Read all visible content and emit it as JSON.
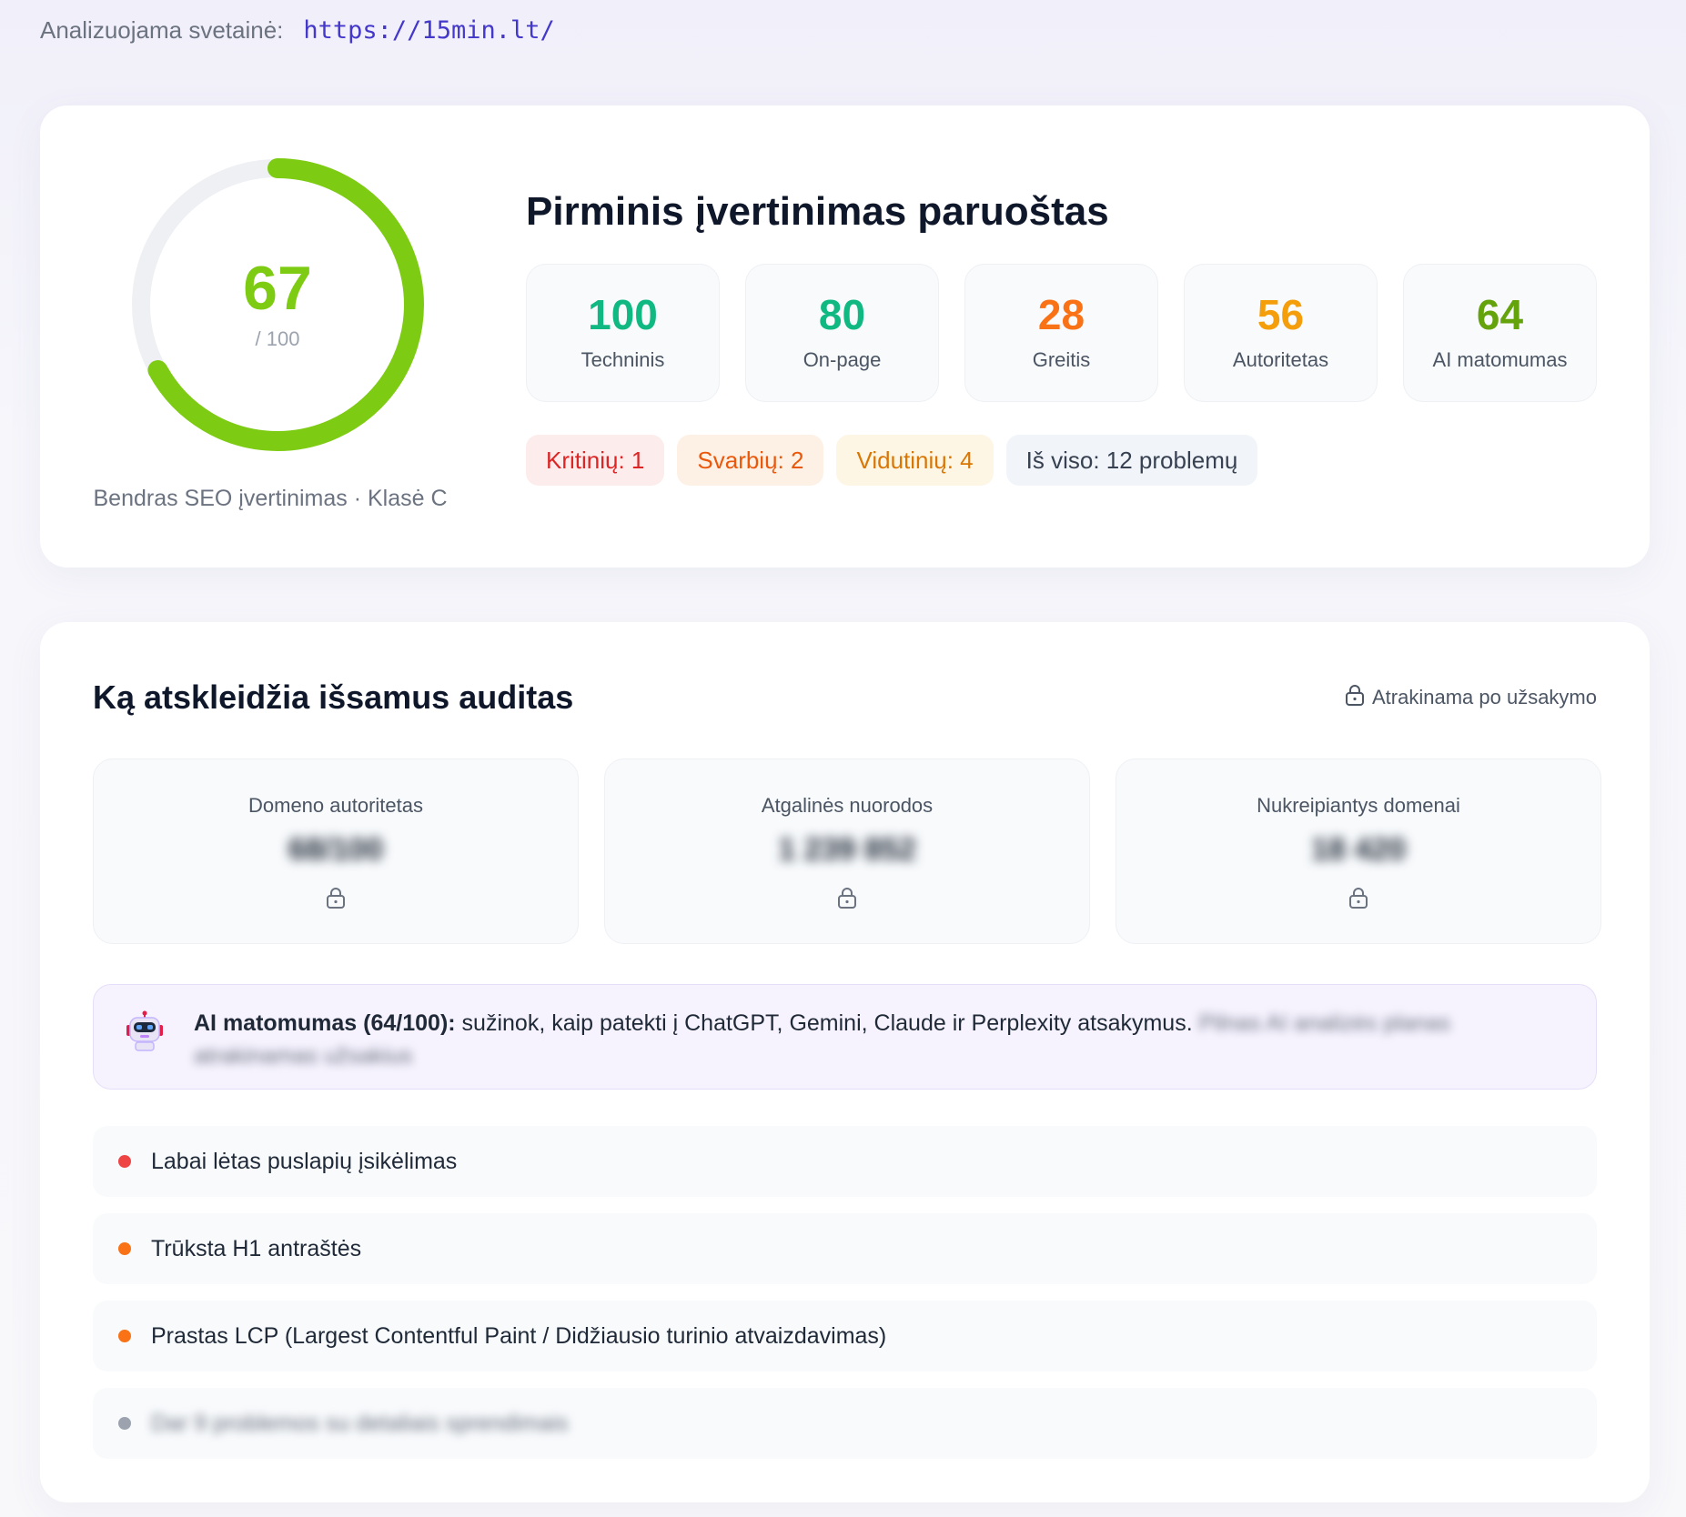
{
  "site": {
    "label": "Analizuojama svetainė:",
    "url": "https://15min.lt/"
  },
  "summary": {
    "score": {
      "value": "67",
      "max": "/ 100",
      "fraction": 0.67
    },
    "caption": "Bendras SEO įvertinimas · Klasė C",
    "title": "Pirminis įvertinimas paruoštas",
    "categories": [
      {
        "value": "100",
        "label": "Techninis",
        "color": "#10b981"
      },
      {
        "value": "80",
        "label": "On-page",
        "color": "#10b981"
      },
      {
        "value": "28",
        "label": "Greitis",
        "color": "#f97316"
      },
      {
        "value": "56",
        "label": "Autoritetas",
        "color": "#f59e0b"
      },
      {
        "value": "64",
        "label": "AI matomumas",
        "color": "#65a30d"
      }
    ],
    "pills": {
      "critical": "Kritinių: 1",
      "important": "Svarbių: 2",
      "medium": "Vidutinių: 4",
      "total": "Iš viso: 12 problemų"
    },
    "gauge_color": "#7ecb14"
  },
  "audit": {
    "title": "Ką atskleidžia išsamus auditas",
    "unlock_note": "Atrakinama po užsakymo",
    "metrics": [
      {
        "label": "Domeno autoritetas",
        "value": "68/100"
      },
      {
        "label": "Atgalinės nuorodos",
        "value": "1 239 852"
      },
      {
        "label": "Nukreipiantys domenai",
        "value": "18 420"
      }
    ],
    "ai": {
      "bold": "AI matomumas (64/100):",
      "text": " sužinok, kaip patekti į ChatGPT, Gemini, Claude ir Perplexity atsakymus.",
      "blurred": "Pilnas AI analizės planas atrakinamas užsakius"
    },
    "issues": [
      {
        "text": "Labai lėtas puslapių įsikėlimas",
        "color": "#ef4444"
      },
      {
        "text": "Trūksta H1 antraštės",
        "color": "#f97316"
      },
      {
        "text": "Prastas LCP (Largest Contentful Paint / Didžiausio turinio atvaizdavimas)",
        "color": "#f97316"
      },
      {
        "text": "Dar 9 problemos su detaliais sprendimais",
        "color": "#9ca3af"
      }
    ]
  }
}
